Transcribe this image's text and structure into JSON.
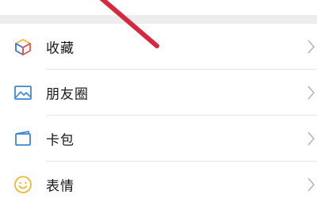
{
  "menu": {
    "items": [
      {
        "label": "收藏",
        "icon": "favorites-cube-icon"
      },
      {
        "label": "朋友圈",
        "icon": "moments-image-icon"
      },
      {
        "label": "卡包",
        "icon": "card-wallet-icon"
      },
      {
        "label": "表情",
        "icon": "sticker-smile-icon"
      }
    ]
  },
  "colors": {
    "accent_red": "#d8283f",
    "favorites_blue": "#2f7ad9",
    "favorites_yellow": "#f4b531",
    "favorites_red": "#e5534b",
    "moments_blue": "#3d86d8",
    "card_blue": "#3d86d8",
    "sticker_yellow": "#f3b62f",
    "text": "#181818",
    "chevron": "#b5b5b5",
    "section_gap": "#ededed"
  }
}
